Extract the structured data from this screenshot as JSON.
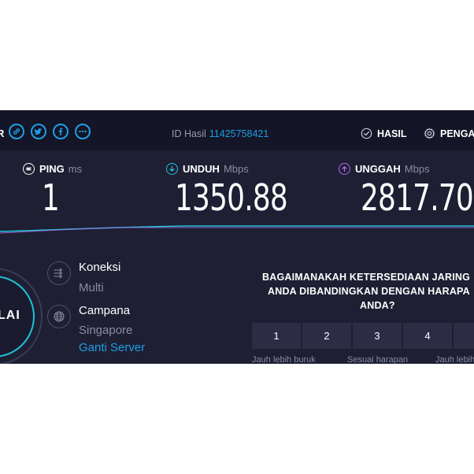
{
  "topbar": {
    "share_label": "R",
    "result_id_label": "ID Hasil",
    "result_id_value": "11425758421",
    "results_label": "HASIL",
    "settings_label": "PENGA"
  },
  "metrics": {
    "ping": {
      "label": "PING",
      "unit": "ms",
      "value": "1"
    },
    "download": {
      "label": "UNDUH",
      "unit": "Mbps",
      "value": "1350.88"
    },
    "upload": {
      "label": "UNGGAH",
      "unit": "Mbps",
      "value": "2817.70"
    }
  },
  "go_button": {
    "label": "LAI"
  },
  "connection": {
    "title": "Koneksi",
    "value": "Multi"
  },
  "server": {
    "title": "Campana",
    "location": "Singapore",
    "change_label": "Ganti Server"
  },
  "survey": {
    "question_line1": "BAGAIMANAKAH KETERSEDIAAN JARING",
    "question_line2": "ANDA DIBANDINGKAN DENGAN HARAPA",
    "question_line3": "ANDA?",
    "options": [
      "1",
      "2",
      "3",
      "4"
    ],
    "label_low": "Jauh lebih buruk",
    "label_mid": "Sesuai harapan",
    "label_high": "Jauh lebih"
  },
  "colors": {
    "accent_blue": "#1d9fe6",
    "download_cyan": "#1fc3d9",
    "upload_purple": "#b06ee8",
    "background": "#1e1f33",
    "topbar": "#141526"
  }
}
